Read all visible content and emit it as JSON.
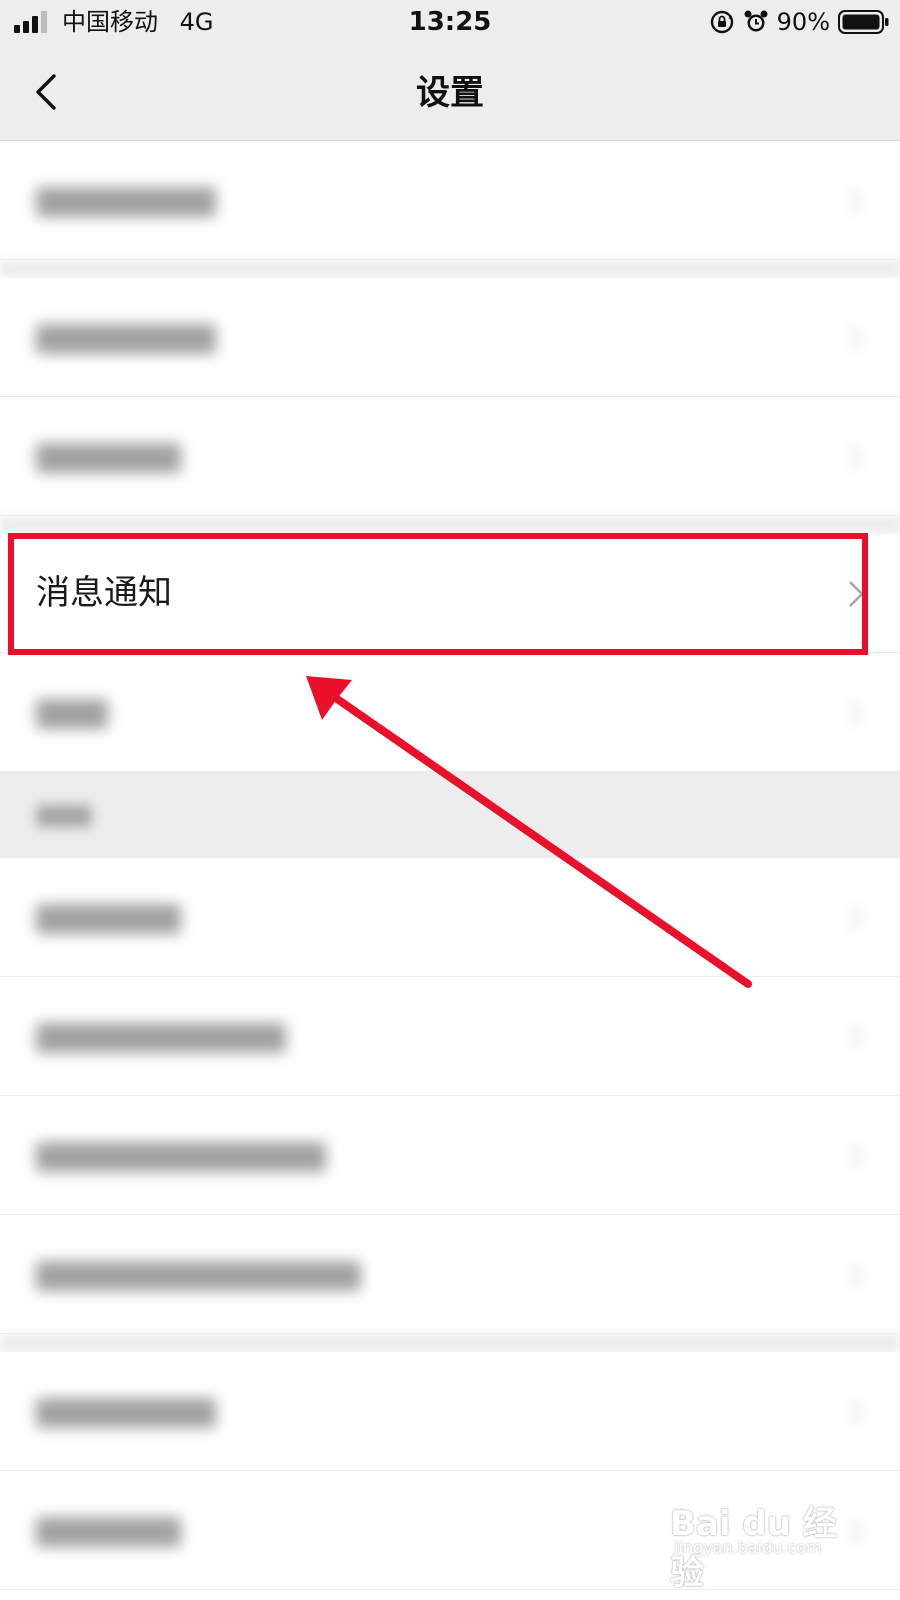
{
  "status_bar": {
    "carrier": "中国移动",
    "network": "4G",
    "time": "13:25",
    "battery": "90%",
    "icons": [
      "signal-icon",
      "rotation-lock-icon",
      "alarm-icon",
      "battery-icon"
    ]
  },
  "nav": {
    "title": "设置",
    "back_icon": "back-chevron-icon"
  },
  "highlighted_item": {
    "label": "消息通知",
    "chevron_icon": "chevron-right-icon"
  },
  "annotation": {
    "box_color": "#e8102a",
    "arrow_color": "#e8102a"
  },
  "watermark": {
    "logo": "Bai du 经验",
    "url": "jingyan.baidu.com"
  },
  "colors": {
    "nav_background": "#ededed",
    "list_background": "#ffffff",
    "annotation_red": "#e8102a"
  }
}
